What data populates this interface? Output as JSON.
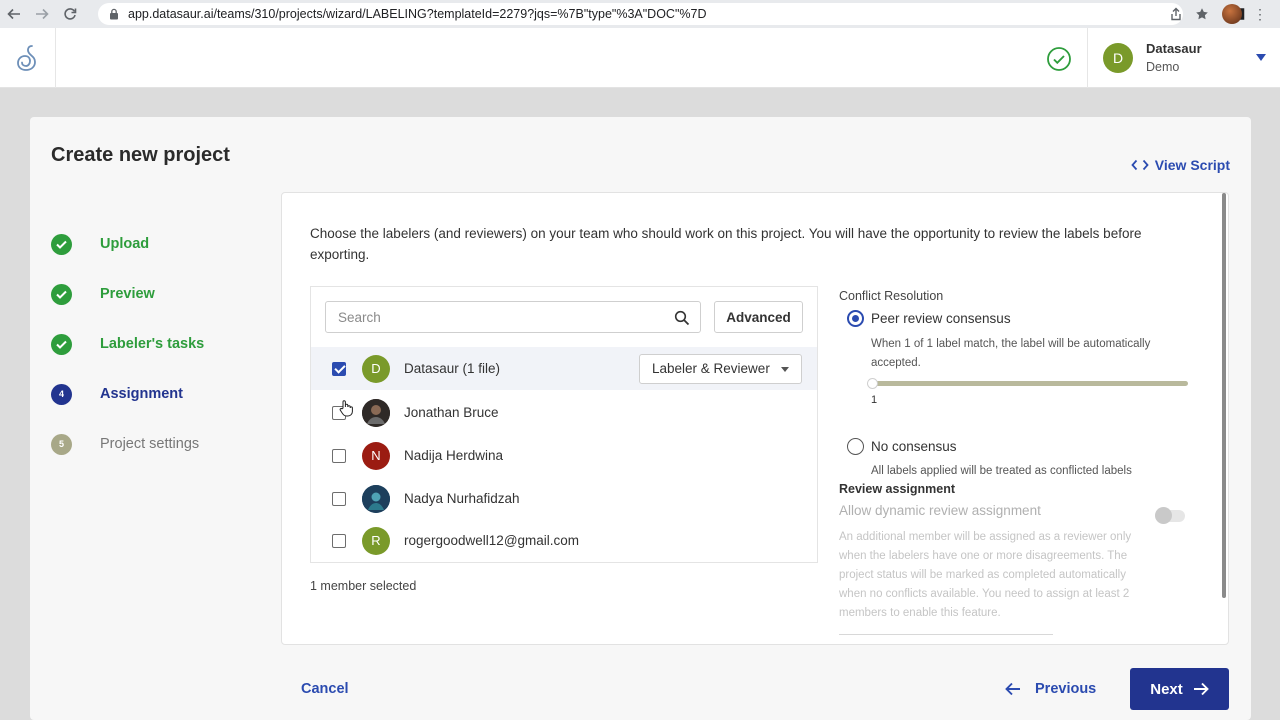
{
  "browser": {
    "url": "app.datasaur.ai/teams/310/projects/wizard/LABELING?templateId=2279?jqs=%7B\"type\"%3A\"DOC\"%7D"
  },
  "header": {
    "user": {
      "initial": "D",
      "name": "Datasaur",
      "team": "Demo"
    }
  },
  "page": {
    "title": "Create new project",
    "view_script": "View Script"
  },
  "steps": [
    {
      "num": "",
      "label": "Upload",
      "state": "done"
    },
    {
      "num": "",
      "label": "Preview",
      "state": "done"
    },
    {
      "num": "",
      "label": "Labeler's tasks",
      "state": "done"
    },
    {
      "num": "4",
      "label": "Assignment",
      "state": "active"
    },
    {
      "num": "5",
      "label": "Project settings",
      "state": "todo"
    }
  ],
  "assignment": {
    "intro": "Choose the labelers (and reviewers) on your team who should work on this project. You will have the opportunity to review the labels before exporting.",
    "search_placeholder": "Search",
    "advanced_label": "Advanced",
    "members": [
      {
        "initial": "D",
        "name": "Datasaur (1 file)",
        "checked": true,
        "color": "#7a9a2a",
        "role": "Labeler & Reviewer"
      },
      {
        "initial": "",
        "name": "Jonathan Bruce",
        "checked": false,
        "color": "#3a3330"
      },
      {
        "initial": "N",
        "name": "Nadija Herdwina",
        "checked": false,
        "color": "#9b1c12"
      },
      {
        "initial": "",
        "name": "Nadya Nurhafidzah",
        "checked": false,
        "color": "#1f4b6e"
      },
      {
        "initial": "R",
        "name": "rogergoodwell12@gmail.com",
        "checked": false,
        "color": "#7a9a2a"
      }
    ],
    "selected_count": "1 member selected"
  },
  "conflict": {
    "title": "Conflict Resolution",
    "peer_label": "Peer review consensus",
    "peer_help": "When 1 of 1 label match, the label will be automatically accepted.",
    "slider_value": "1",
    "no_consensus_label": "No consensus",
    "no_consensus_help": "All labels applied will be treated as conflicted labels",
    "review_title": "Review assignment",
    "dynamic_label": "Allow dynamic review assignment",
    "dynamic_desc": "An additional member will be assigned as a reviewer only when the labelers have one or more disagreements. The project status will be marked as completed automatically when no conflicts available. You need to assign at least 2 members to enable this feature."
  },
  "footer": {
    "cancel": "Cancel",
    "previous": "Previous",
    "next": "Next"
  },
  "colors": {
    "primary": "#2b4bb0",
    "primary_dark": "#22348f",
    "success": "#2e9d3c"
  }
}
